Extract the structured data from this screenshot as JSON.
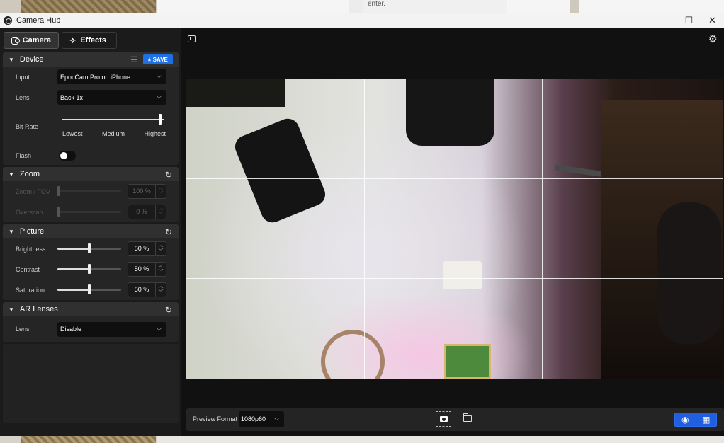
{
  "window": {
    "title": "Camera Hub",
    "minimize": "—",
    "maximize": "☐",
    "close": "✕"
  },
  "background": {
    "snippet": "enter."
  },
  "tabs": [
    {
      "label": "Camera"
    },
    {
      "label": "Effects"
    }
  ],
  "device": {
    "title": "Device",
    "save_label": "SAVE",
    "input_label": "Input",
    "input_value": "EpocCam Pro on iPhone",
    "lens_label": "Lens",
    "lens_value": "Back 1x",
    "bitrate_label": "Bit Rate",
    "bitrate_ticks": [
      "Lowest",
      "Medium",
      "Highest"
    ],
    "bitrate_value": "Highest",
    "flash_label": "Flash",
    "flash_on": false
  },
  "zoom": {
    "title": "Zoom",
    "zoom_label": "Zoom / FOV",
    "zoom_value": "100 %",
    "overscan_label": "Overscan",
    "overscan_value": "0 %"
  },
  "picture": {
    "title": "Picture",
    "brightness_label": "Brightness",
    "brightness_value": "50 %",
    "contrast_label": "Contrast",
    "contrast_value": "50 %",
    "saturation_label": "Saturation",
    "saturation_value": "50 %"
  },
  "ar": {
    "title": "AR Lenses",
    "lens_label": "Lens",
    "lens_value": "Disable"
  },
  "bottom": {
    "preview_format_label": "Preview Format",
    "preview_format_value": "1080p60"
  },
  "colors": {
    "accent": "#1f6fe5",
    "panel": "#252525",
    "header": "#303030",
    "background": "#111111"
  },
  "icons": {
    "tab_camera": "camera-icon",
    "tab_effects": "magic-wand-icon",
    "device_tune": "sliders-icon",
    "save": "download-icon",
    "reset": "reset-icon",
    "settings": "gear-icon",
    "panel_toggle": "sidebar-toggle-icon",
    "snapshot": "snapshot-icon",
    "folder": "folder-icon",
    "preview_eye": "eye-icon",
    "grid": "grid-icon"
  }
}
